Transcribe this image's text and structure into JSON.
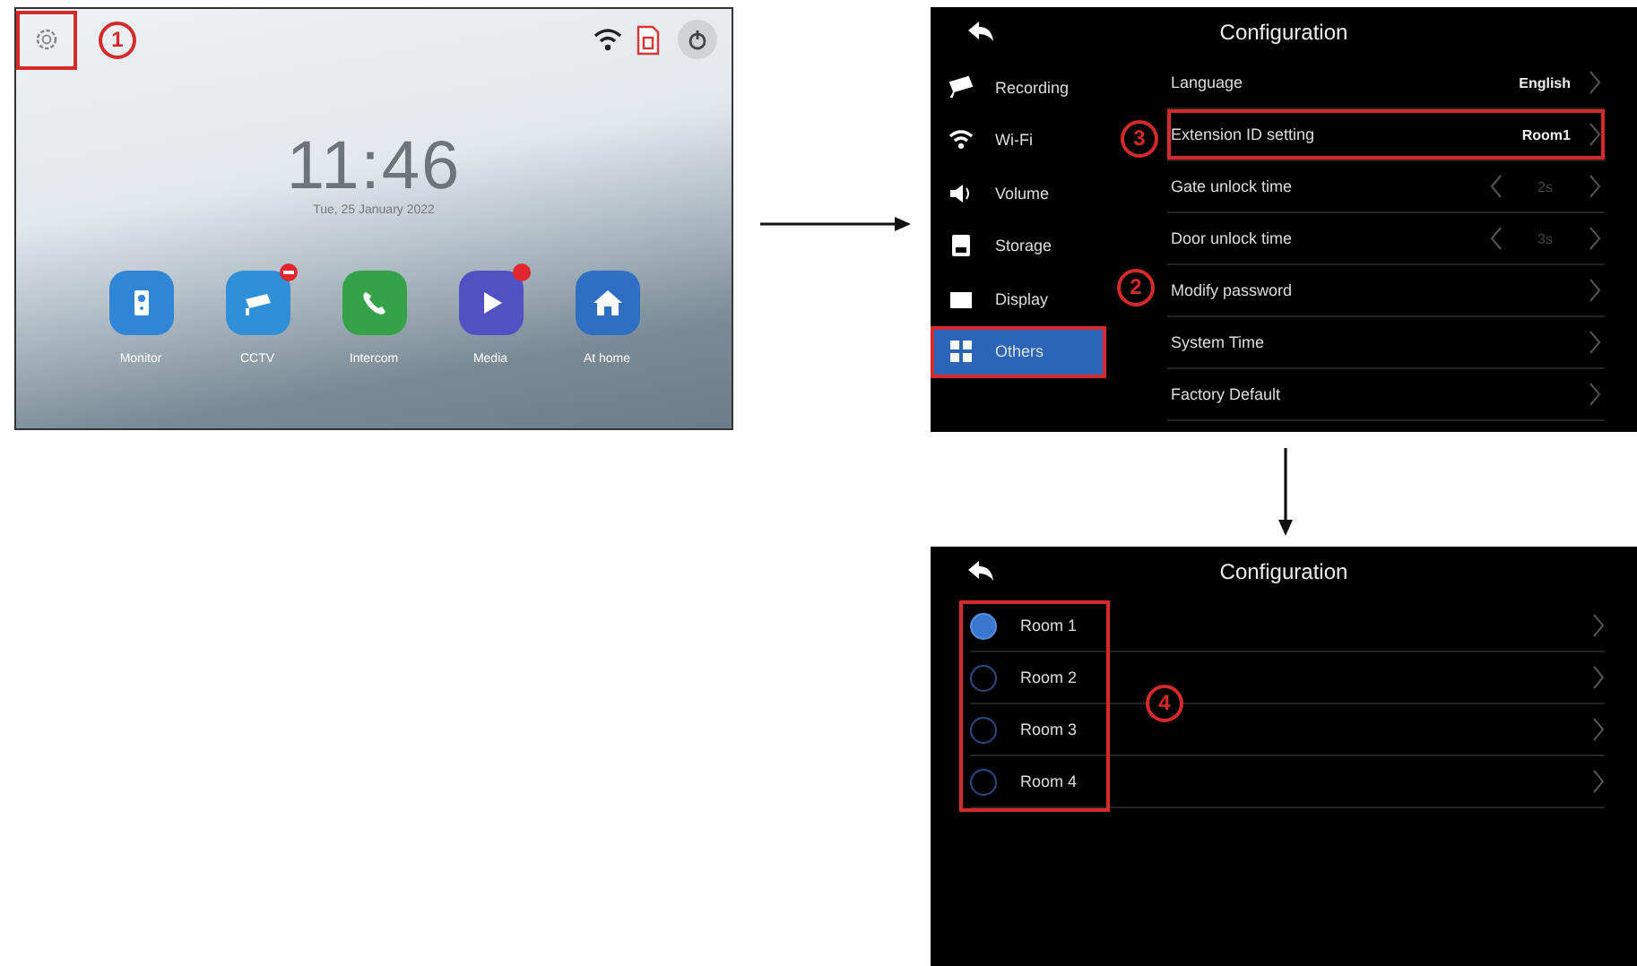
{
  "home_screen": {
    "settings_highlighted": true,
    "callout": "1",
    "time": "11:46",
    "date": "Tue, 25 January 2022",
    "apps": [
      {
        "label": "Monitor",
        "color": "#2f86d6",
        "kind": "plain"
      },
      {
        "label": "CCTV",
        "color": "#2f8fd8",
        "kind": "removable"
      },
      {
        "label": "Intercom",
        "color": "#35a24a",
        "kind": "plain"
      },
      {
        "label": "Media",
        "color": "#5151c4",
        "kind": "notified"
      },
      {
        "label": "At home",
        "color": "#2e6fc4",
        "kind": "plain"
      }
    ]
  },
  "config_screen": {
    "title": "Configuration",
    "sidebar_callout": "2",
    "settings_callout": "3",
    "sidebar": [
      {
        "label": "Recording",
        "selected": false,
        "highlighted": false
      },
      {
        "label": "Wi-Fi",
        "selected": false,
        "highlighted": false
      },
      {
        "label": "Volume",
        "selected": false,
        "highlighted": false
      },
      {
        "label": "Storage",
        "selected": false,
        "highlighted": false
      },
      {
        "label": "Display",
        "selected": false,
        "highlighted": false
      },
      {
        "label": "Others",
        "selected": true,
        "highlighted": true
      }
    ],
    "settings": [
      {
        "label": "Language",
        "value": "English",
        "kind": "link",
        "highlighted": false
      },
      {
        "label": "Extension ID setting",
        "value": "Room1",
        "kind": "link",
        "highlighted": true
      },
      {
        "label": "Gate unlock time",
        "value": "2s",
        "kind": "stepper",
        "highlighted": false
      },
      {
        "label": "Door unlock time",
        "value": "3s",
        "kind": "stepper",
        "highlighted": false
      },
      {
        "label": "Modify  password",
        "kind": "link",
        "highlighted": false
      },
      {
        "label": "System Time",
        "kind": "link",
        "highlighted": false
      },
      {
        "label": "Factory Default",
        "kind": "link",
        "highlighted": false
      }
    ]
  },
  "room_screen": {
    "title": "Configuration",
    "callout": "4",
    "list_highlighted": true,
    "rooms": [
      {
        "label": "Room 1",
        "selected": true
      },
      {
        "label": "Room 2",
        "selected": false
      },
      {
        "label": "Room 3",
        "selected": false
      },
      {
        "label": "Room 4",
        "selected": false
      }
    ]
  }
}
